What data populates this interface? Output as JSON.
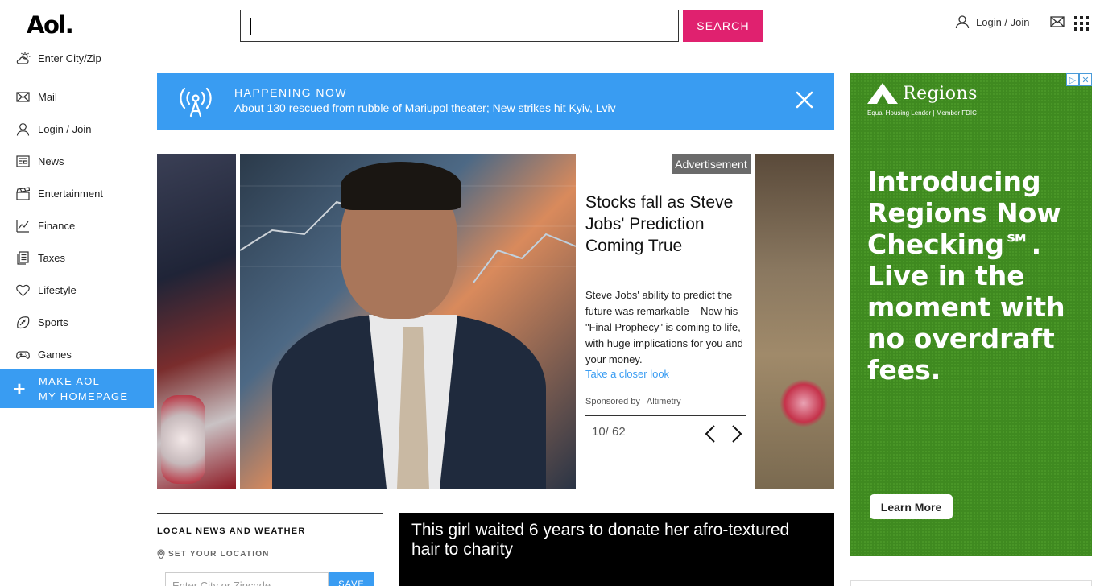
{
  "header": {
    "logo": "Aol.",
    "search_button": "SEARCH",
    "login_label": "Login / Join"
  },
  "sidebar": {
    "weather_label": "Enter City/Zip",
    "items": [
      {
        "label": "Mail",
        "icon": "mail-icon"
      },
      {
        "label": "Login / Join",
        "icon": "user-icon"
      },
      {
        "label": "News",
        "icon": "newspaper-icon"
      },
      {
        "label": "Entertainment",
        "icon": "clapperboard-icon"
      },
      {
        "label": "Finance",
        "icon": "chart-icon"
      },
      {
        "label": "Taxes",
        "icon": "document-icon"
      },
      {
        "label": "Lifestyle",
        "icon": "heart-icon"
      },
      {
        "label": "Sports",
        "icon": "football-icon"
      },
      {
        "label": "Games",
        "icon": "gamepad-icon"
      }
    ],
    "make_homepage_line1": "MAKE AOL",
    "make_homepage_line2": "MY HOMEPAGE"
  },
  "banner": {
    "label": "HAPPENING NOW",
    "headline": "About 130 rescued from rubble of Mariupol theater; New strikes hit Kyiv, Lviv"
  },
  "carousel": {
    "ad_tag": "Advertisement",
    "title": "Stocks fall as Steve Jobs' Prediction Coming True",
    "description": "Steve Jobs' ability to predict the future was remarkable – Now his \"Final Prophecy\" is coming to life, with huge implications for you and your money.",
    "link": "Take a closer look",
    "sponsored_by": "Sponsored by",
    "sponsor": "Altimetry",
    "pager": "10/ 62"
  },
  "ad": {
    "brand": "Regions",
    "brand_sub": "Equal Housing Lender | Member FDIC",
    "headline": "Introducing Regions Now Checking℠. Live in the moment with no overdraft fees.",
    "button": "Learn More"
  },
  "local": {
    "title": "LOCAL NEWS AND WEATHER",
    "set_location": "SET YOUR LOCATION",
    "city_placeholder": "Enter City or Zipcode",
    "save": "SAVE"
  },
  "video": {
    "title": "This girl waited 6 years to donate her afro-textured hair to charity"
  },
  "colors": {
    "accent_pink": "#e0216f",
    "accent_blue": "#399cf2",
    "ad_green": "#3f8a20"
  }
}
